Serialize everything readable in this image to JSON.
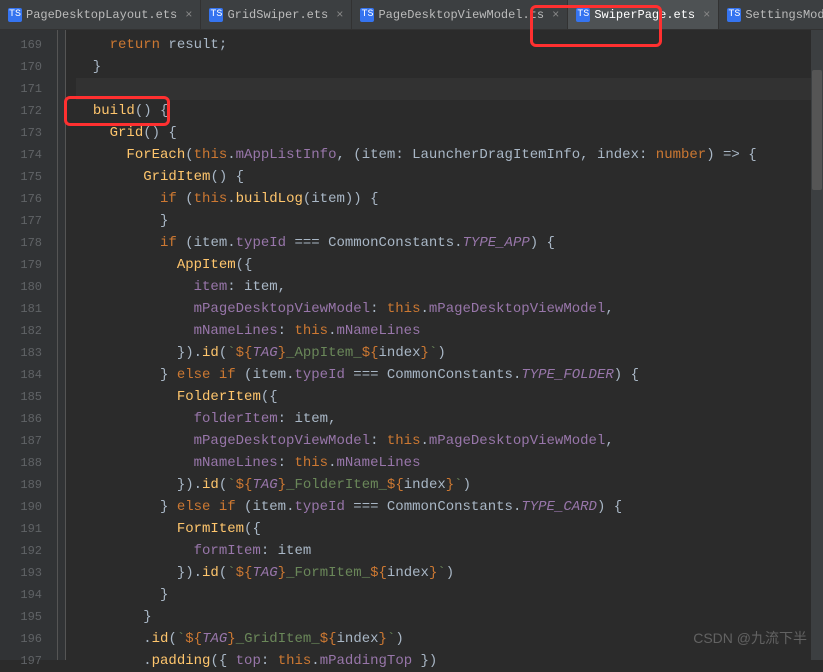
{
  "tabs": [
    {
      "label": "PageDesktopLayout.ets",
      "active": false
    },
    {
      "label": "GridSwiper.ets",
      "active": false
    },
    {
      "label": "PageDesktopViewModel.ts",
      "active": false
    },
    {
      "label": "SwiperPage.ets",
      "active": true
    },
    {
      "label": "SettingsModel.ts",
      "active": false
    }
  ],
  "line_numbers": [
    "169",
    "170",
    "171",
    "172",
    "173",
    "174",
    "175",
    "176",
    "177",
    "178",
    "179",
    "180",
    "181",
    "182",
    "183",
    "184",
    "185",
    "186",
    "187",
    "188",
    "189",
    "190",
    "191",
    "192",
    "193",
    "194",
    "195",
    "196",
    "197"
  ],
  "code_lines": {
    "l169": {
      "indent": "    ",
      "tokens": [
        {
          "t": "kw",
          "v": "return "
        },
        {
          "t": "",
          "v": "result;"
        }
      ]
    },
    "l170": {
      "indent": "  ",
      "tokens": [
        {
          "t": "",
          "v": "}"
        }
      ]
    },
    "l171": {
      "indent": "",
      "tokens": []
    },
    "l172": {
      "indent": "  ",
      "tokens": [
        {
          "t": "fn",
          "v": "build"
        },
        {
          "t": "",
          "v": "() {"
        }
      ]
    },
    "l173": {
      "indent": "    ",
      "tokens": [
        {
          "t": "comp",
          "v": "Grid"
        },
        {
          "t": "",
          "v": "() {"
        }
      ]
    },
    "l174": {
      "indent": "      ",
      "tokens": [
        {
          "t": "comp",
          "v": "ForEach"
        },
        {
          "t": "",
          "v": "("
        },
        {
          "t": "this",
          "v": "this"
        },
        {
          "t": "",
          "v": "."
        },
        {
          "t": "prop",
          "v": "mAppListInfo"
        },
        {
          "t": "",
          "v": ", ("
        },
        {
          "t": "param",
          "v": "item"
        },
        {
          "t": "",
          "v": ": "
        },
        {
          "t": "type",
          "v": "LauncherDragItemInfo"
        },
        {
          "t": "",
          "v": ", "
        },
        {
          "t": "param",
          "v": "index"
        },
        {
          "t": "",
          "v": ": "
        },
        {
          "t": "kw",
          "v": "number"
        },
        {
          "t": "",
          "v": ") => {"
        }
      ]
    },
    "l175": {
      "indent": "        ",
      "tokens": [
        {
          "t": "comp",
          "v": "GridItem"
        },
        {
          "t": "",
          "v": "() {"
        }
      ]
    },
    "l176": {
      "indent": "          ",
      "tokens": [
        {
          "t": "kw",
          "v": "if "
        },
        {
          "t": "",
          "v": "("
        },
        {
          "t": "this",
          "v": "this"
        },
        {
          "t": "",
          "v": "."
        },
        {
          "t": "fn",
          "v": "buildLog"
        },
        {
          "t": "",
          "v": "("
        },
        {
          "t": "param",
          "v": "item"
        },
        {
          "t": "",
          "v": ")) {"
        }
      ]
    },
    "l177": {
      "indent": "          ",
      "tokens": [
        {
          "t": "",
          "v": "}"
        }
      ]
    },
    "l178": {
      "indent": "          ",
      "tokens": [
        {
          "t": "kw",
          "v": "if "
        },
        {
          "t": "",
          "v": "("
        },
        {
          "t": "param",
          "v": "item"
        },
        {
          "t": "",
          "v": "."
        },
        {
          "t": "prop",
          "v": "typeId"
        },
        {
          "t": "",
          "v": " === "
        },
        {
          "t": "type",
          "v": "CommonConstants"
        },
        {
          "t": "",
          "v": "."
        },
        {
          "t": "const",
          "v": "TYPE_APP"
        },
        {
          "t": "",
          "v": ") {"
        }
      ]
    },
    "l179": {
      "indent": "            ",
      "tokens": [
        {
          "t": "comp",
          "v": "AppItem"
        },
        {
          "t": "",
          "v": "({"
        }
      ]
    },
    "l180": {
      "indent": "              ",
      "tokens": [
        {
          "t": "prop",
          "v": "item"
        },
        {
          "t": "",
          "v": ": "
        },
        {
          "t": "param",
          "v": "item"
        },
        {
          "t": "",
          "v": ","
        }
      ]
    },
    "l181": {
      "indent": "              ",
      "tokens": [
        {
          "t": "prop",
          "v": "mPageDesktopViewModel"
        },
        {
          "t": "",
          "v": ": "
        },
        {
          "t": "this",
          "v": "this"
        },
        {
          "t": "",
          "v": "."
        },
        {
          "t": "prop",
          "v": "mPageDesktopViewModel"
        },
        {
          "t": "",
          "v": ","
        }
      ]
    },
    "l182": {
      "indent": "              ",
      "tokens": [
        {
          "t": "prop",
          "v": "mNameLines"
        },
        {
          "t": "",
          "v": ": "
        },
        {
          "t": "this",
          "v": "this"
        },
        {
          "t": "",
          "v": "."
        },
        {
          "t": "prop",
          "v": "mNameLines"
        }
      ]
    },
    "l183": {
      "indent": "            ",
      "tokens": [
        {
          "t": "",
          "v": "})."
        },
        {
          "t": "fn",
          "v": "id"
        },
        {
          "t": "",
          "v": "("
        },
        {
          "t": "str",
          "v": "`"
        },
        {
          "t": "tmpl",
          "v": "${"
        },
        {
          "t": "const",
          "v": "TAG"
        },
        {
          "t": "tmpl",
          "v": "}"
        },
        {
          "t": "str",
          "v": "_AppItem_"
        },
        {
          "t": "tmpl",
          "v": "${"
        },
        {
          "t": "param",
          "v": "index"
        },
        {
          "t": "tmpl",
          "v": "}"
        },
        {
          "t": "str",
          "v": "`"
        },
        {
          "t": "",
          "v": ")"
        }
      ]
    },
    "l184": {
      "indent": "          ",
      "tokens": [
        {
          "t": "",
          "v": "} "
        },
        {
          "t": "kw",
          "v": "else if "
        },
        {
          "t": "",
          "v": "("
        },
        {
          "t": "param",
          "v": "item"
        },
        {
          "t": "",
          "v": "."
        },
        {
          "t": "prop",
          "v": "typeId"
        },
        {
          "t": "",
          "v": " === "
        },
        {
          "t": "type",
          "v": "CommonConstants"
        },
        {
          "t": "",
          "v": "."
        },
        {
          "t": "const",
          "v": "TYPE_FOLDER"
        },
        {
          "t": "",
          "v": ") {"
        }
      ]
    },
    "l185": {
      "indent": "            ",
      "tokens": [
        {
          "t": "comp",
          "v": "FolderItem"
        },
        {
          "t": "",
          "v": "({"
        }
      ]
    },
    "l186": {
      "indent": "              ",
      "tokens": [
        {
          "t": "prop",
          "v": "folderItem"
        },
        {
          "t": "",
          "v": ": "
        },
        {
          "t": "param",
          "v": "item"
        },
        {
          "t": "",
          "v": ","
        }
      ]
    },
    "l187": {
      "indent": "              ",
      "tokens": [
        {
          "t": "prop",
          "v": "mPageDesktopViewModel"
        },
        {
          "t": "",
          "v": ": "
        },
        {
          "t": "this",
          "v": "this"
        },
        {
          "t": "",
          "v": "."
        },
        {
          "t": "prop",
          "v": "mPageDesktopViewModel"
        },
        {
          "t": "",
          "v": ","
        }
      ]
    },
    "l188": {
      "indent": "              ",
      "tokens": [
        {
          "t": "prop",
          "v": "mNameLines"
        },
        {
          "t": "",
          "v": ": "
        },
        {
          "t": "this",
          "v": "this"
        },
        {
          "t": "",
          "v": "."
        },
        {
          "t": "prop",
          "v": "mNameLines"
        }
      ]
    },
    "l189": {
      "indent": "            ",
      "tokens": [
        {
          "t": "",
          "v": "})."
        },
        {
          "t": "fn",
          "v": "id"
        },
        {
          "t": "",
          "v": "("
        },
        {
          "t": "str",
          "v": "`"
        },
        {
          "t": "tmpl",
          "v": "${"
        },
        {
          "t": "const",
          "v": "TAG"
        },
        {
          "t": "tmpl",
          "v": "}"
        },
        {
          "t": "str",
          "v": "_FolderItem_"
        },
        {
          "t": "tmpl",
          "v": "${"
        },
        {
          "t": "param",
          "v": "index"
        },
        {
          "t": "tmpl",
          "v": "}"
        },
        {
          "t": "str",
          "v": "`"
        },
        {
          "t": "",
          "v": ")"
        }
      ]
    },
    "l190": {
      "indent": "          ",
      "tokens": [
        {
          "t": "",
          "v": "} "
        },
        {
          "t": "kw",
          "v": "else if "
        },
        {
          "t": "",
          "v": "("
        },
        {
          "t": "param",
          "v": "item"
        },
        {
          "t": "",
          "v": "."
        },
        {
          "t": "prop",
          "v": "typeId"
        },
        {
          "t": "",
          "v": " === "
        },
        {
          "t": "type",
          "v": "CommonConstants"
        },
        {
          "t": "",
          "v": "."
        },
        {
          "t": "const",
          "v": "TYPE_CARD"
        },
        {
          "t": "",
          "v": ") {"
        }
      ]
    },
    "l191": {
      "indent": "            ",
      "tokens": [
        {
          "t": "comp",
          "v": "FormItem"
        },
        {
          "t": "",
          "v": "({"
        }
      ]
    },
    "l192": {
      "indent": "              ",
      "tokens": [
        {
          "t": "prop",
          "v": "formItem"
        },
        {
          "t": "",
          "v": ": "
        },
        {
          "t": "param",
          "v": "item"
        }
      ]
    },
    "l193": {
      "indent": "            ",
      "tokens": [
        {
          "t": "",
          "v": "})."
        },
        {
          "t": "fn",
          "v": "id"
        },
        {
          "t": "",
          "v": "("
        },
        {
          "t": "str",
          "v": "`"
        },
        {
          "t": "tmpl",
          "v": "${"
        },
        {
          "t": "const",
          "v": "TAG"
        },
        {
          "t": "tmpl",
          "v": "}"
        },
        {
          "t": "str",
          "v": "_FormItem_"
        },
        {
          "t": "tmpl",
          "v": "${"
        },
        {
          "t": "param",
          "v": "index"
        },
        {
          "t": "tmpl",
          "v": "}"
        },
        {
          "t": "str",
          "v": "`"
        },
        {
          "t": "",
          "v": ")"
        }
      ]
    },
    "l194": {
      "indent": "          ",
      "tokens": [
        {
          "t": "",
          "v": "}"
        }
      ]
    },
    "l195": {
      "indent": "        ",
      "tokens": [
        {
          "t": "",
          "v": "}"
        }
      ]
    },
    "l196": {
      "indent": "        ",
      "tokens": [
        {
          "t": "",
          "v": "."
        },
        {
          "t": "fn",
          "v": "id"
        },
        {
          "t": "",
          "v": "("
        },
        {
          "t": "str",
          "v": "`"
        },
        {
          "t": "tmpl",
          "v": "${"
        },
        {
          "t": "const",
          "v": "TAG"
        },
        {
          "t": "tmpl",
          "v": "}"
        },
        {
          "t": "str",
          "v": "_GridItem_"
        },
        {
          "t": "tmpl",
          "v": "${"
        },
        {
          "t": "param",
          "v": "index"
        },
        {
          "t": "tmpl",
          "v": "}"
        },
        {
          "t": "str",
          "v": "`"
        },
        {
          "t": "",
          "v": ")"
        }
      ]
    },
    "l197": {
      "indent": "        ",
      "tokens": [
        {
          "t": "",
          "v": "."
        },
        {
          "t": "fn",
          "v": "padding"
        },
        {
          "t": "",
          "v": "({ "
        },
        {
          "t": "prop",
          "v": "top"
        },
        {
          "t": "",
          "v": ": "
        },
        {
          "t": "this",
          "v": "this"
        },
        {
          "t": "",
          "v": "."
        },
        {
          "t": "prop",
          "v": "mPaddingTop"
        },
        {
          "t": "",
          "v": " })"
        }
      ]
    }
  },
  "watermark": "CSDN @九流下半",
  "close_glyph": "×",
  "ts_badge": "TS"
}
